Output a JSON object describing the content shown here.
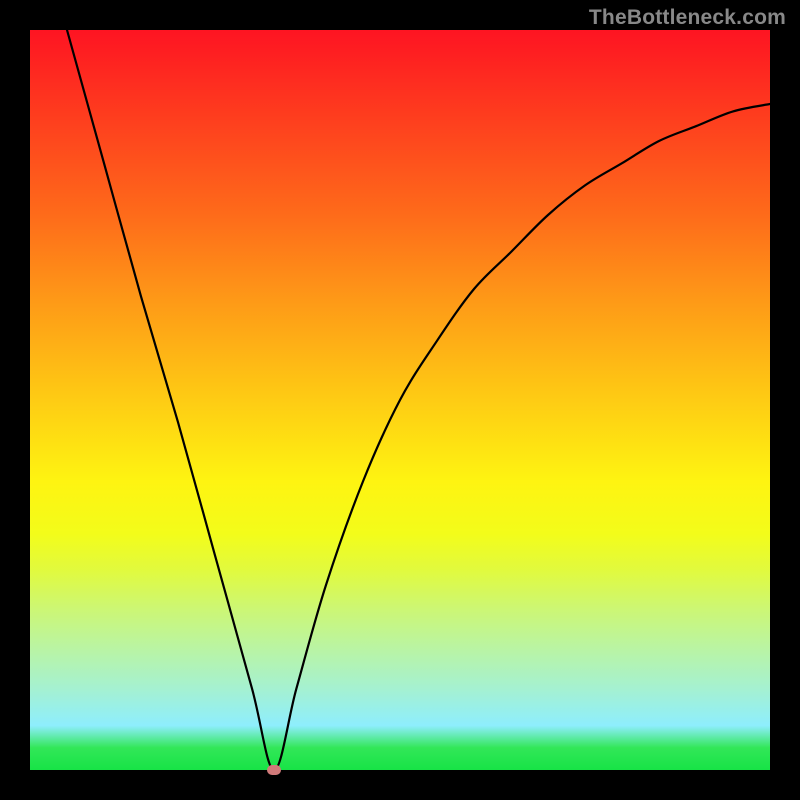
{
  "watermark": "TheBottleneck.com",
  "chart_data": {
    "type": "line",
    "title": "",
    "xlabel": "",
    "ylabel": "",
    "xlim": [
      0,
      100
    ],
    "ylim": [
      0,
      100
    ],
    "minimum_marker": {
      "x": 33,
      "y": 0
    },
    "series": [
      {
        "name": "curve",
        "x": [
          5,
          10,
          15,
          20,
          25,
          30,
          33,
          36,
          40,
          45,
          50,
          55,
          60,
          65,
          70,
          75,
          80,
          85,
          90,
          95,
          100
        ],
        "y": [
          100,
          82,
          64,
          47,
          29,
          11,
          0,
          11,
          25,
          39,
          50,
          58,
          65,
          70,
          75,
          79,
          82,
          85,
          87,
          89,
          90
        ]
      }
    ],
    "gradient_stops": [
      {
        "pct": 0,
        "color": "#fe1422"
      },
      {
        "pct": 12,
        "color": "#fe3e1e"
      },
      {
        "pct": 25,
        "color": "#fe6b1a"
      },
      {
        "pct": 37,
        "color": "#fe9b17"
      },
      {
        "pct": 49,
        "color": "#fec814"
      },
      {
        "pct": 61,
        "color": "#fef411"
      },
      {
        "pct": 68,
        "color": "#f3fc1a"
      },
      {
        "pct": 73,
        "color": "#e1fa3e"
      },
      {
        "pct": 78,
        "color": "#cdf772"
      },
      {
        "pct": 84,
        "color": "#b8f4a7"
      },
      {
        "pct": 89,
        "color": "#a5f1d1"
      },
      {
        "pct": 94,
        "color": "#8eeefd"
      },
      {
        "pct": 97,
        "color": "#32e758"
      },
      {
        "pct": 100,
        "color": "#17e346"
      }
    ]
  }
}
